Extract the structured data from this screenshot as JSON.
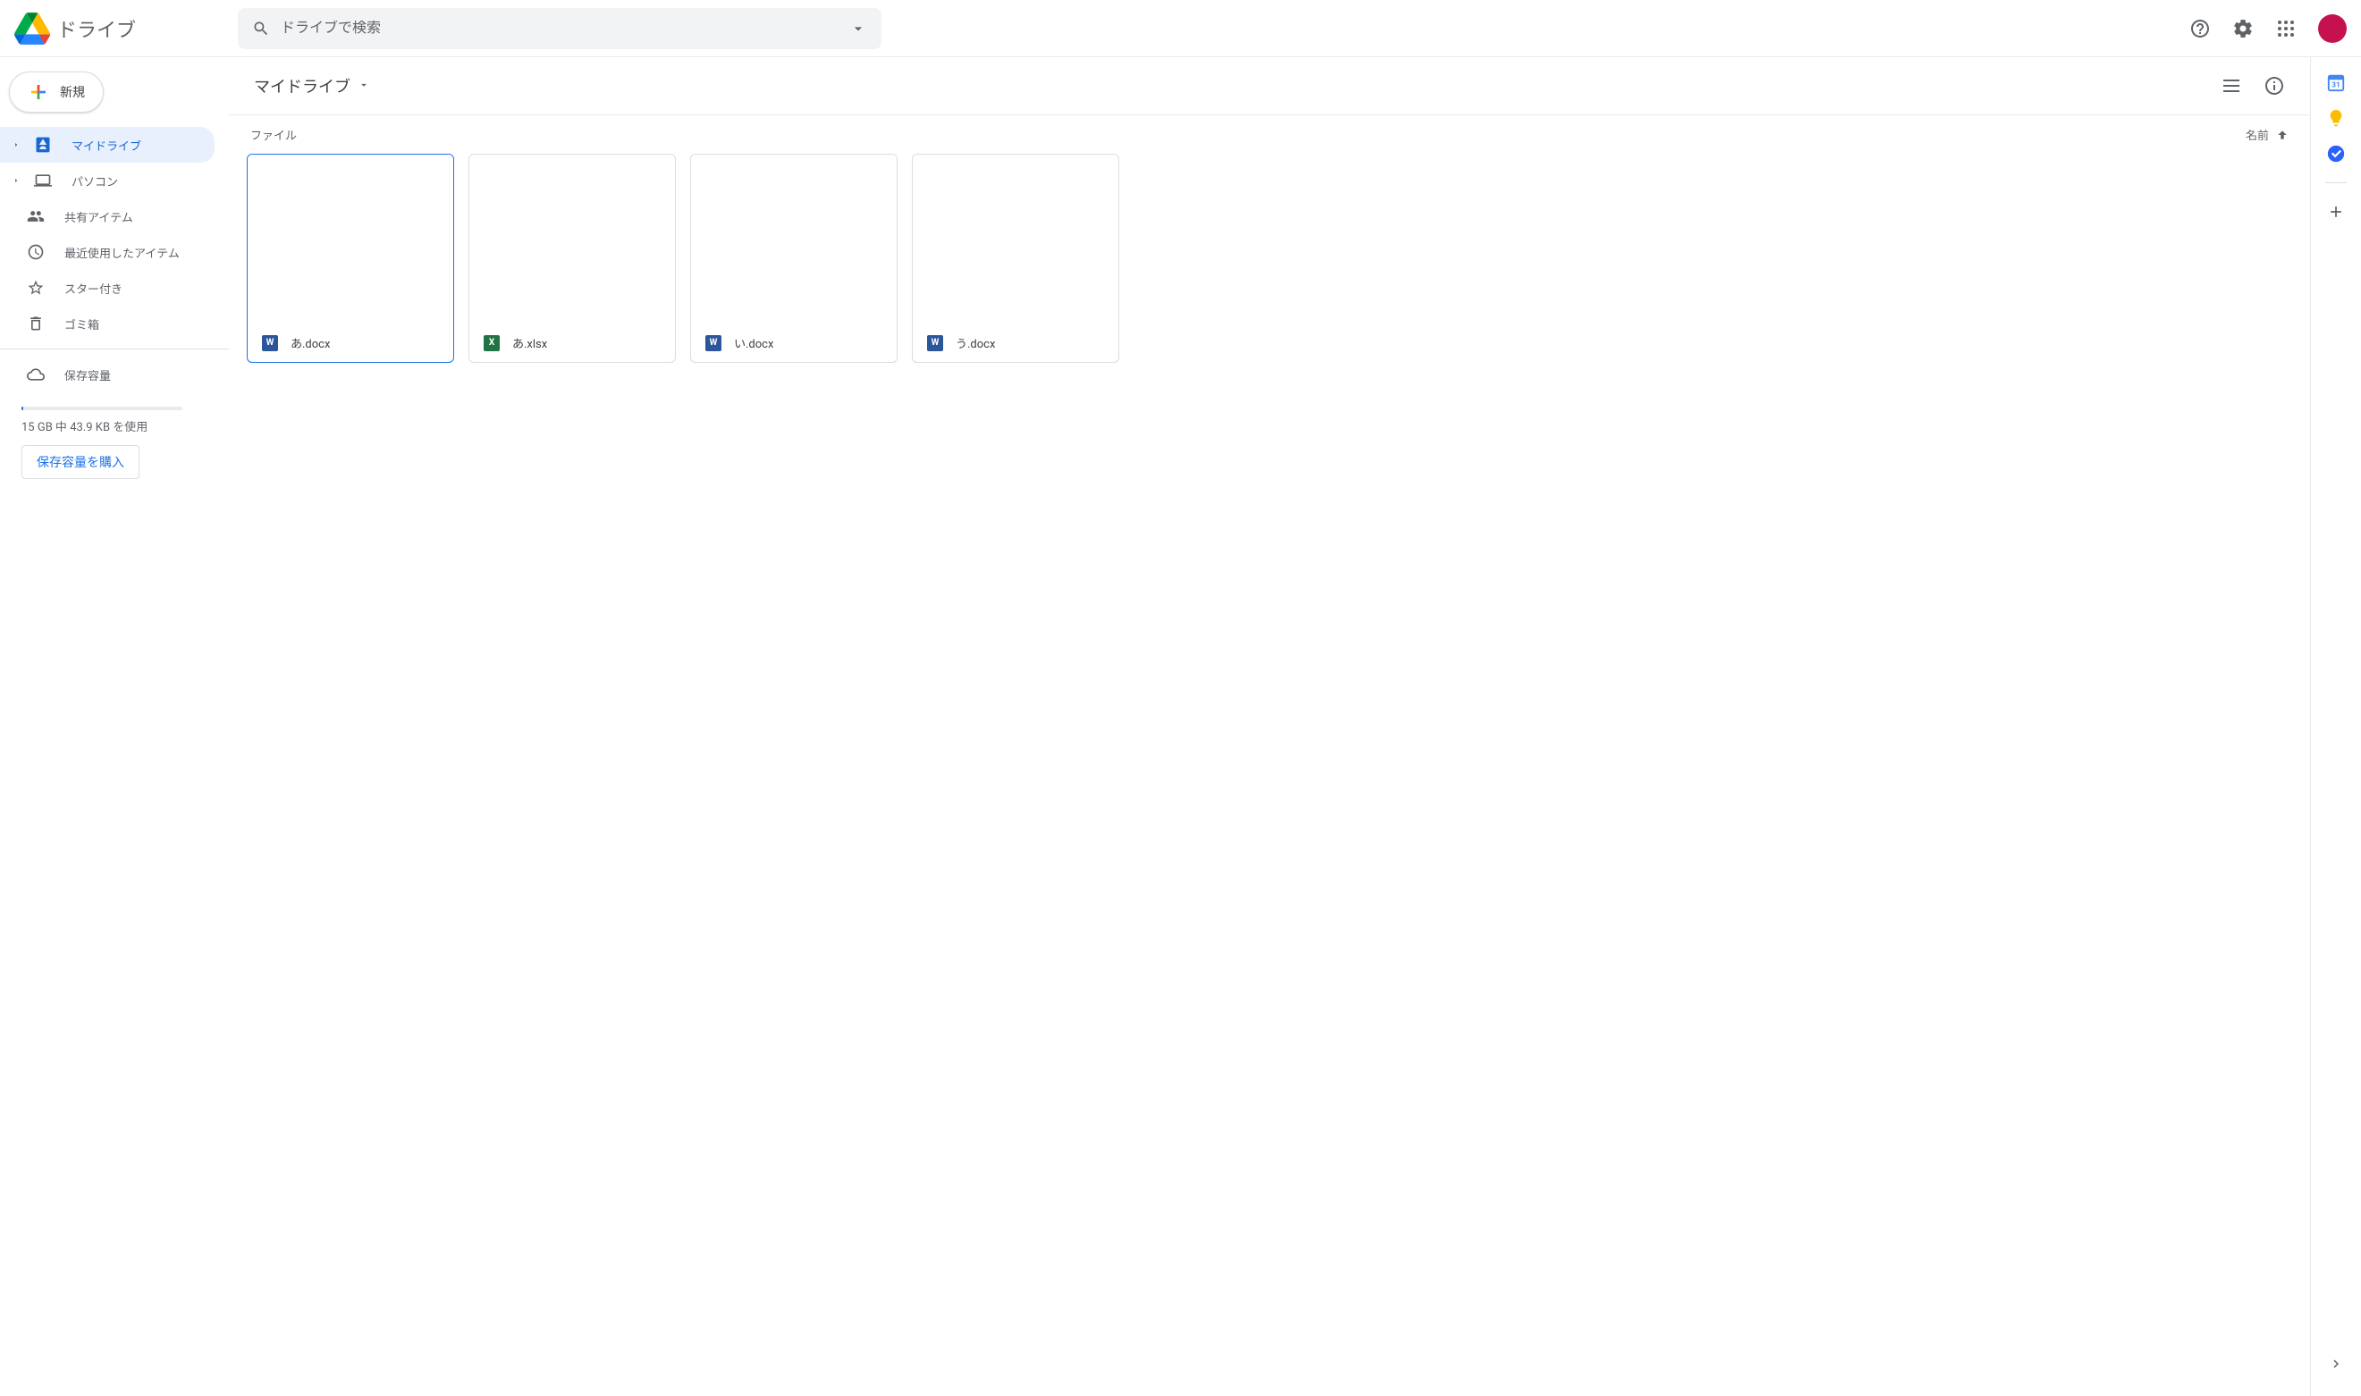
{
  "header": {
    "app_name": "ドライブ",
    "search_placeholder": "ドライブで検索"
  },
  "sidebar": {
    "new_button": "新規",
    "items": [
      {
        "label": "マイドライブ"
      },
      {
        "label": "パソコン"
      },
      {
        "label": "共有アイテム"
      },
      {
        "label": "最近使用したアイテム"
      },
      {
        "label": "スター付き"
      },
      {
        "label": "ゴミ箱"
      }
    ],
    "storage": {
      "label": "保存容量",
      "usage_text": "15 GB 中 43.9 KB を使用",
      "buy_button": "保存容量を購入"
    }
  },
  "content": {
    "breadcrumb": "マイドライブ",
    "section_label": "ファイル",
    "sort_label": "名前",
    "files": [
      {
        "name": "あ.docx",
        "type": "word",
        "type_label": "W",
        "selected": true
      },
      {
        "name": "あ.xlsx",
        "type": "excel",
        "type_label": "X",
        "selected": false
      },
      {
        "name": "い.docx",
        "type": "word",
        "type_label": "W",
        "selected": false
      },
      {
        "name": "う.docx",
        "type": "word",
        "type_label": "W",
        "selected": false
      }
    ]
  }
}
